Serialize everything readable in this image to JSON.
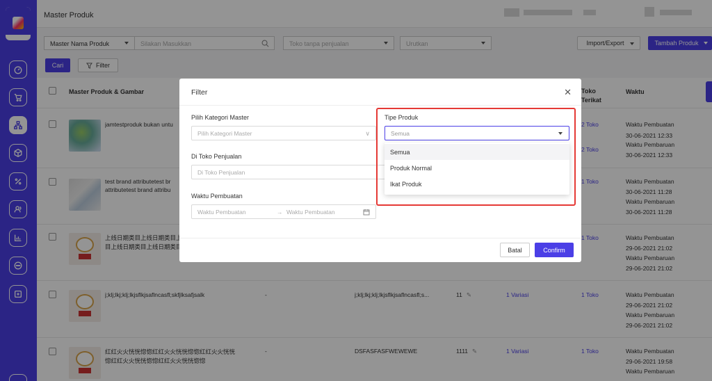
{
  "header": {
    "title": "Master Produk"
  },
  "filterbar": {
    "field_select": "Master Nama Produk",
    "search_placeholder": "Silakan Masukkan",
    "shop_filter": "Toko tanpa penjualan",
    "sort_placeholder": "Urutkan",
    "import_export": "Import/Export",
    "add_product": "Tambah Produk",
    "search_button": "Cari",
    "filter_button": "Filter"
  },
  "table": {
    "columns": {
      "product": "Master Produk & Gambar",
      "toko_terikat_1": "Toko",
      "toko_terikat_2": "Terikat",
      "waktu": "Waktu"
    },
    "rows": [
      {
        "name": "jamtestproduk bukan untu",
        "name2": "",
        "sku": "",
        "stock": "",
        "variasi": "",
        "toko": "2 Toko",
        "label1": "Waktu Pembuatan",
        "date1": "30-06-2021 12:33",
        "label2": "Waktu Pembaruan",
        "date2": "30-06-2021 12:33",
        "toko_b": "2 Toko"
      },
      {
        "name": "test brand attributetest br",
        "name2": "attributetest brand attribu",
        "sku": "",
        "stock": "",
        "variasi": "",
        "toko": "1 Toko",
        "label1": "Waktu Pembuatan",
        "date1": "30-06-2021 11:28",
        "label2": "Waktu Pembaruan",
        "date2": "30-06-2021 11:28"
      },
      {
        "name": "上线日期类目上线日期类目上",
        "name2": "目上线日期类目上线日期类目",
        "sku": "",
        "stock": "",
        "variasi": "",
        "toko": "1 Toko",
        "label1": "Waktu Pembuatan",
        "date1": "29-06-2021 21:02",
        "label2": "Waktu Pembaruan",
        "date2": "29-06-2021 21:02"
      },
      {
        "name": "j;klj;lkj;klj;lkjsflkjsaflncasfl;skfjlksafjsalk",
        "name2": "",
        "dash": "-",
        "sku": "j;klj;lkj;klj;lkjsflkjsaflncasfl;s...",
        "stock": "11",
        "variasi": "1 Variasi",
        "toko": "1 Toko",
        "label1": "Waktu Pembuatan",
        "date1": "29-06-2021 21:02",
        "label2": "Waktu Pembaruan",
        "date2": "29-06-2021 21:02"
      },
      {
        "name": "红红火火恍恍惚惚红红火火恍恍惚惚红红火火恍恍",
        "name2": "惚红红火火恍恍惚惚红红火火恍恍惚惚",
        "dash": "-",
        "sku": "DSFASFASFWEWEWE",
        "stock": "1111",
        "variasi": "1 Variasi",
        "toko": "1 Toko",
        "label1": "Waktu Pembuatan",
        "date1": "29-06-2021 19:58",
        "label2": "Waktu Pembaruan",
        "date2": ""
      }
    ]
  },
  "modal": {
    "title": "Filter",
    "kategori_label": "Pilih Kategori Master",
    "kategori_placeholder": "Pilih Kategori Master",
    "toko_label": "Di Toko Penjualan",
    "toko_placeholder": "Di Toko Penjualan",
    "waktu_label": "Waktu Pembuatan",
    "waktu_start": "Waktu Pembuatan",
    "waktu_arrow": "→",
    "waktu_end": "Waktu Pembuatan",
    "tipe_label": "Tipe Produk",
    "tipe_value": "Semua",
    "tipe_options": [
      "Semua",
      "Produk Normal",
      "Ikat Produk"
    ],
    "cancel": "Batal",
    "confirm": "Confirm"
  },
  "colors": {
    "accent": "#4b3fe6",
    "highlight": "#e53935"
  }
}
